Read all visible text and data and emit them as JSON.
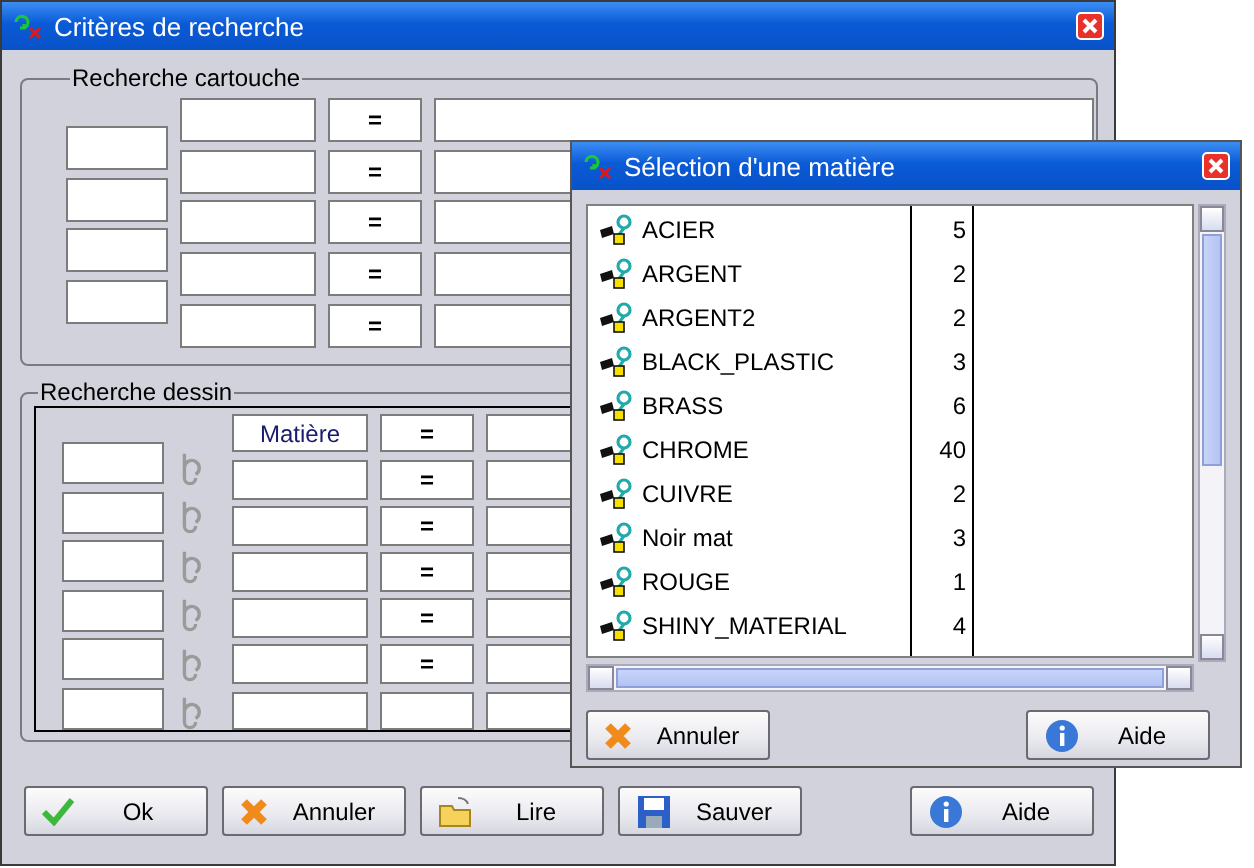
{
  "window": {
    "title": "Critères de recherche"
  },
  "cartouche": {
    "label": "Recherche cartouche",
    "rows": [
      {
        "operator": "="
      },
      {
        "operator": "="
      },
      {
        "operator": "="
      },
      {
        "operator": "="
      },
      {
        "operator": "="
      }
    ]
  },
  "dessin": {
    "label": "Recherche dessin",
    "rows": [
      {
        "attribute": "Matière",
        "operator": "="
      },
      {
        "operator": "="
      },
      {
        "operator": "="
      },
      {
        "operator": "="
      },
      {
        "operator": "="
      },
      {
        "operator": "="
      }
    ]
  },
  "buttons": [
    {
      "label": "Ok",
      "kind": "ok"
    },
    {
      "label": "Annuler",
      "kind": "cancel"
    },
    {
      "label": "Lire",
      "kind": "open"
    },
    {
      "label": "Sauver",
      "kind": "save"
    },
    {
      "label": "Aide",
      "kind": "help"
    }
  ],
  "dialog": {
    "title": "Sélection d'une matière",
    "materials": [
      {
        "name": "ACIER",
        "count": "5"
      },
      {
        "name": "ARGENT",
        "count": "2"
      },
      {
        "name": "ARGENT2",
        "count": "2"
      },
      {
        "name": "BLACK_PLASTIC",
        "count": "3"
      },
      {
        "name": "BRASS",
        "count": "6"
      },
      {
        "name": "CHROME",
        "count": "40"
      },
      {
        "name": "CUIVRE",
        "count": "2"
      },
      {
        "name": "Noir mat",
        "count": "3"
      },
      {
        "name": "ROUGE",
        "count": "1"
      },
      {
        "name": "SHINY_MATERIAL",
        "count": "4"
      }
    ],
    "buttons": [
      {
        "label": "Annuler",
        "kind": "cancel"
      },
      {
        "label": "Aide",
        "kind": "help"
      }
    ]
  }
}
